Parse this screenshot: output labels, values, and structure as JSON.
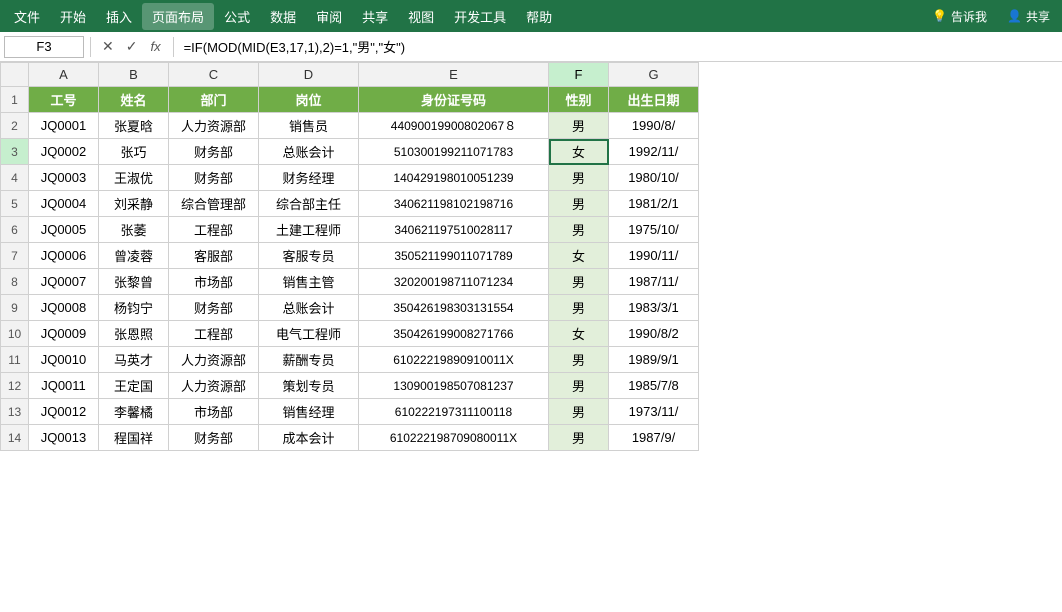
{
  "menu": {
    "items": [
      "文件",
      "开始",
      "插入",
      "页面布局",
      "公式",
      "数据",
      "审阅",
      "共享",
      "视图",
      "开发工具",
      "帮助"
    ],
    "active": "页面布局",
    "right": [
      "告诉我",
      "共享"
    ]
  },
  "formula_bar": {
    "cell_ref": "F3",
    "formula": "=IF(MOD(MID(E3,17,1),2)=1,\"男\",\"女\")",
    "fx": "fx"
  },
  "columns": {
    "headers": [
      "A",
      "B",
      "C",
      "D",
      "E",
      "F",
      "G"
    ],
    "row_header": ""
  },
  "header_row": {
    "labels": [
      "工号",
      "姓名",
      "部门",
      "岗位",
      "身份证号码",
      "性别",
      "出生日期"
    ]
  },
  "rows": [
    {
      "row": "2",
      "A": "JQ0001",
      "B": "张夏晗",
      "C": "人力资源部",
      "D": "销售员",
      "E": "44090019900802067８",
      "F": "男",
      "G": "1990/8/"
    },
    {
      "row": "3",
      "A": "JQ0002",
      "B": "张巧",
      "C": "财务部",
      "D": "总账会计",
      "E": "510300199211071783",
      "F": "女",
      "G": "1992/11/"
    },
    {
      "row": "4",
      "A": "JQ0003",
      "B": "王淑优",
      "C": "财务部",
      "D": "财务经理",
      "E": "140429198010051239",
      "F": "男",
      "G": "1980/10/"
    },
    {
      "row": "5",
      "A": "JQ0004",
      "B": "刘采静",
      "C": "综合管理部",
      "D": "综合部主任",
      "E": "340621198102198716",
      "F": "男",
      "G": "1981/2/1"
    },
    {
      "row": "6",
      "A": "JQ0005",
      "B": "张萎",
      "C": "工程部",
      "D": "土建工程师",
      "E": "340621197510028117",
      "F": "男",
      "G": "1975/10/"
    },
    {
      "row": "7",
      "A": "JQ0006",
      "B": "曾凌蓉",
      "C": "客服部",
      "D": "客服专员",
      "E": "350521199011071789",
      "F": "女",
      "G": "1990/11/"
    },
    {
      "row": "8",
      "A": "JQ0007",
      "B": "张黎曾",
      "C": "市场部",
      "D": "销售主管",
      "E": "320200198711071234",
      "F": "男",
      "G": "1987/11/"
    },
    {
      "row": "9",
      "A": "JQ0008",
      "B": "杨钧宁",
      "C": "财务部",
      "D": "总账会计",
      "E": "350426198303131554",
      "F": "男",
      "G": "1983/3/1"
    },
    {
      "row": "10",
      "A": "JQ0009",
      "B": "张恩照",
      "C": "工程部",
      "D": "电气工程师",
      "E": "350426199008271766",
      "F": "女",
      "G": "1990/8/2"
    },
    {
      "row": "11",
      "A": "JQ0010",
      "B": "马英才",
      "C": "人力资源部",
      "D": "薪酬专员",
      "E": "61022219890910011X",
      "F": "男",
      "G": "1989/9/1"
    },
    {
      "row": "12",
      "A": "JQ0011",
      "B": "王定国",
      "C": "人力资源部",
      "D": "策划专员",
      "E": "130900198507081237",
      "F": "男",
      "G": "1985/7/8"
    },
    {
      "row": "13",
      "A": "JQ0012",
      "B": "李馨橘",
      "C": "市场部",
      "D": "销售经理",
      "E": "610222197311100118",
      "F": "男",
      "G": "1973/11/"
    },
    {
      "row": "14",
      "A": "JQ0013",
      "B": "程国祥",
      "C": "财务部",
      "D": "成本会计",
      "E": "610222198709080011X",
      "F": "男",
      "G": "1987/9/"
    }
  ]
}
